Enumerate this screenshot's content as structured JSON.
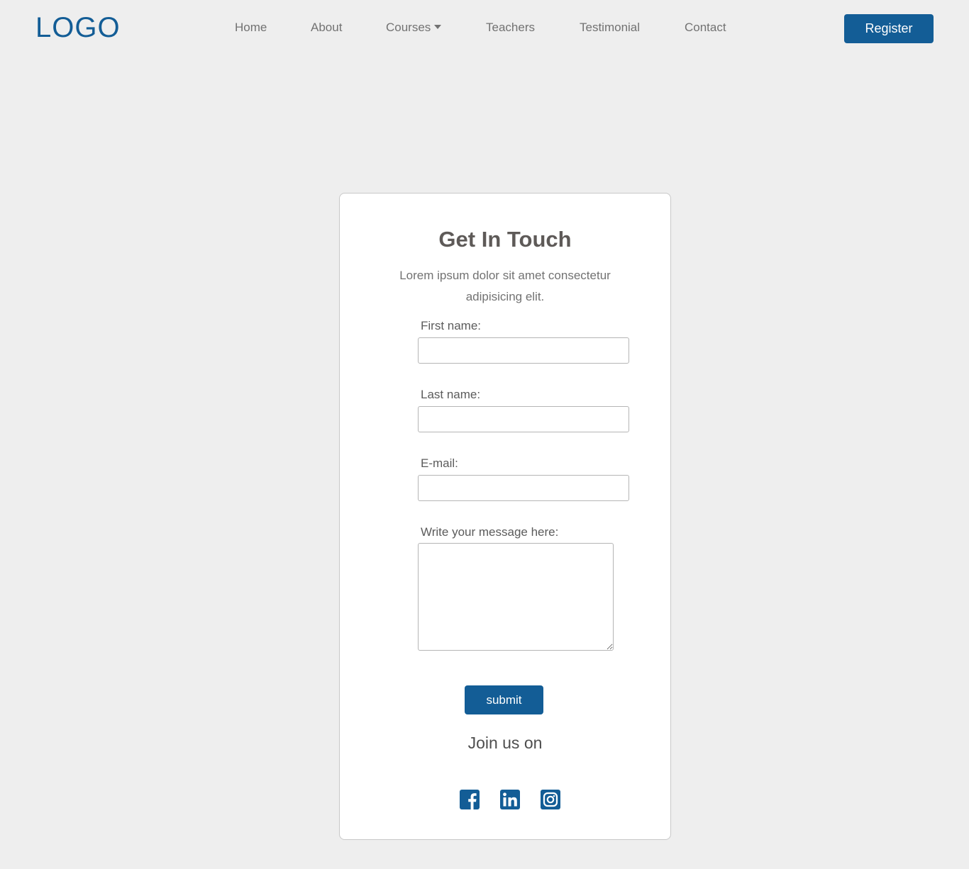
{
  "header": {
    "logo": "LOGO",
    "nav": [
      {
        "label": "Home"
      },
      {
        "label": "About"
      },
      {
        "label": "Courses",
        "has_dropdown": true
      },
      {
        "label": "Teachers"
      },
      {
        "label": "Testimonial"
      },
      {
        "label": "Contact"
      }
    ],
    "register_label": "Register"
  },
  "contact": {
    "title": "Get In Touch",
    "description": "Lorem ipsum dolor sit amet consectetur adipisicing elit.",
    "fields": {
      "first_name": {
        "label": "First name:",
        "value": ""
      },
      "last_name": {
        "label": "Last name:",
        "value": ""
      },
      "email": {
        "label": "E-mail:",
        "value": ""
      },
      "message": {
        "label": "Write your message here:",
        "value": ""
      }
    },
    "submit_label": "submit",
    "join_text": "Join us on",
    "socials": [
      "facebook-icon",
      "linkedin-icon",
      "instagram-icon"
    ]
  },
  "colors": {
    "accent": "#135d96",
    "background": "#eeeeee",
    "nav_text": "#727272",
    "title_text": "#5e5a58"
  }
}
